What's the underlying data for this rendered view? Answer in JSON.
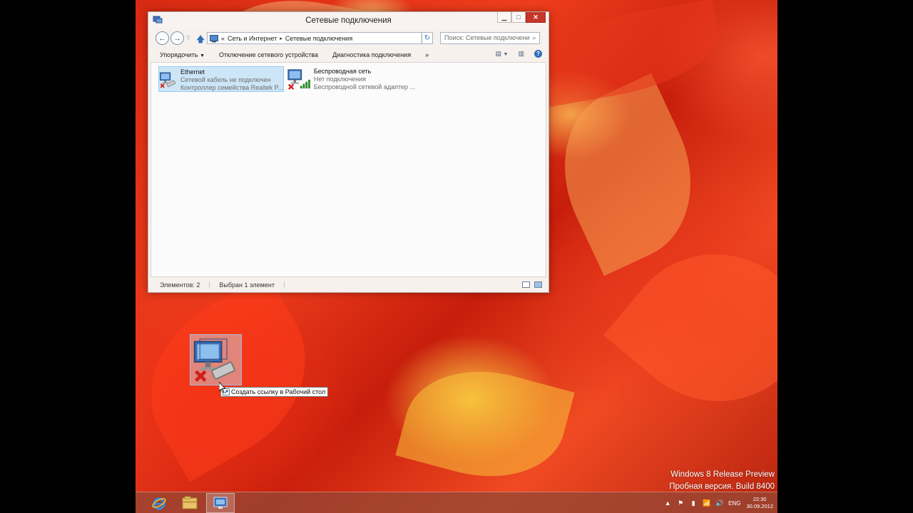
{
  "window": {
    "title": "Сетевые подключения"
  },
  "address": {
    "prefix": "«",
    "crumbs": [
      "Сеть и Интернет",
      "Сетевые подключения"
    ],
    "separator": "▸"
  },
  "search": {
    "placeholder": "Поиск: Сетевые подключения"
  },
  "toolbar": {
    "organize": "Упорядочить",
    "disable_device": "Отключение сетевого устройства",
    "diagnose": "Диагностика подключения",
    "more": "»"
  },
  "connections": [
    {
      "name": "Ethernet",
      "status": "Сетевой кабель не подключен",
      "adapter": "Контроллер семейства Realtek P...",
      "selected": true,
      "icon": "ethernet-disconnected-icon"
    },
    {
      "name": "Беспроводная сеть",
      "status": "Нет подключения",
      "adapter": "Беспроводной сетевой адаптер ...",
      "selected": false,
      "icon": "wireless-disconnected-icon"
    }
  ],
  "statusbar": {
    "items_count": "Элементов: 2",
    "selected_count": "Выбран 1 элемент"
  },
  "drag": {
    "tooltip": "Создать ссылку в Рабочий стол"
  },
  "watermark": {
    "line1": "Windows 8 Release Preview",
    "line2": "Пробная версия. Build 8400"
  },
  "taskbar": {
    "apps": [
      "internet-explorer-icon",
      "file-explorer-icon",
      "network-connections-icon"
    ],
    "language": "ENG",
    "time": "22:30",
    "date": "30.09.2012"
  },
  "colors": {
    "selection": "#cde6f7",
    "selection_border": "#99c9ef",
    "close_button": "#c7342a",
    "taskbar": "#96463a"
  }
}
